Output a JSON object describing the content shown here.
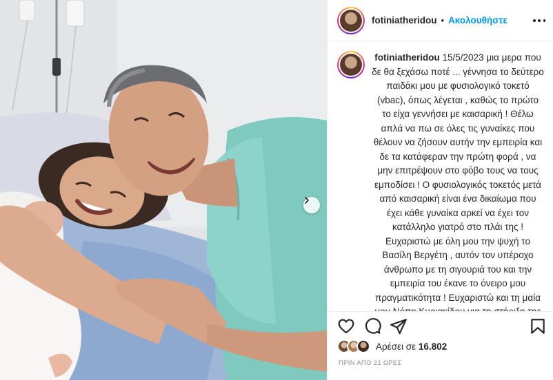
{
  "post": {
    "username": "fotiniatheridou",
    "follow_label": "Ακολουθήστε",
    "separator": "•",
    "caption": {
      "username": "fotiniatheridou",
      "date": "15/5/2023",
      "text": "μια μερα που δε θα ξεχάσω ποτέ ... γέννησα το δεύτερο παιδάκι μου με φυσιολογικό τοκετό (vbac), όπως λέγεται , καθώς το πρώτο το είχα γεννήσει με καισαρική ! Θέλω απλά να πω σε όλες τις γυναίκες που θέλουν να ζήσουν αυτήν την εμπειρία και δε τα κατάφεραν την πρώτη φορά , να μην επιτρέψουν στο φόβο τους να τους εμποδίσει ! Ο φυσιολογικός τοκετός μετά από καισαρική είναι ένα δικαίωμα που έχει κάθε γυναίκα αρκεί να έχει τον κατάλληλο γιατρό στο πλάι της ! Ευχαριστώ με όλη μου την ψυχή το Βασίλη Βεργέτη , αυτόν τον υπέροχο άνθρωπο με τη σιγουριά του και την εμπειρία του έκανε το όνειρο μου πραγματικότητα ! Ευχαριστώ και τη μαία μου Νόπη Κυριακίδου για τη στήριξη της όλες"
    },
    "likes_prefix": "Αρέσει σε",
    "likes_count": "16.802",
    "timestamp": "ΠΡΙΝ ΑΠΟ 21 ΩΡΕΣ"
  },
  "colors": {
    "link_blue": "#0095f6",
    "text": "#262626",
    "muted": "#8e8e8e",
    "scrubs": "#7fc9bf"
  },
  "icons": [
    "heart-icon",
    "comment-icon",
    "share-icon",
    "bookmark-icon",
    "more-icon",
    "chevron-right-icon"
  ]
}
